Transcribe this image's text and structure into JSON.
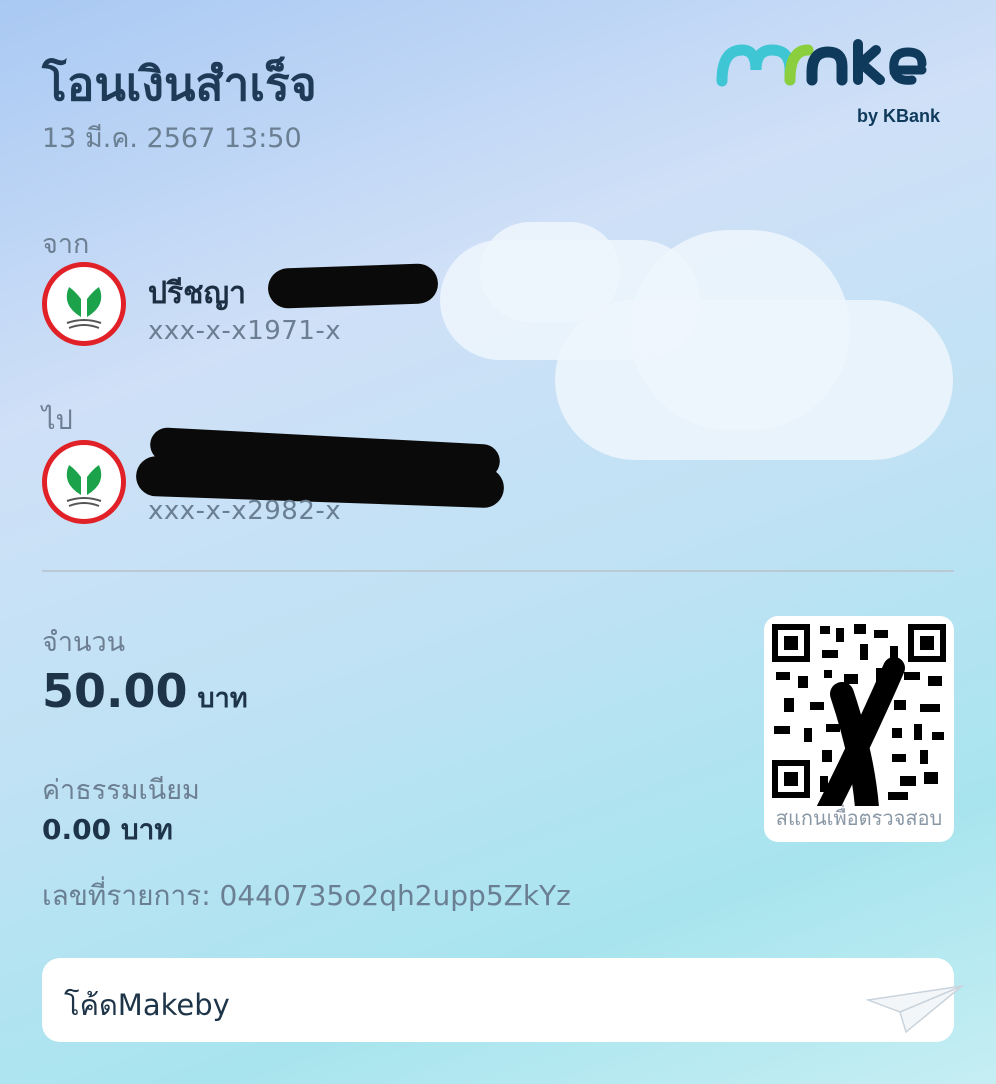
{
  "header": {
    "title": "โอนเงินสำเร็จ",
    "datetime": "13 มี.ค. 2567 13:50",
    "brand_logo_text": "make",
    "brand_sub": "by KBank"
  },
  "from": {
    "label": "จาก",
    "name": "ปรีชญา",
    "account": "xxx-x-x1971-x",
    "bank_icon": "kbank-leaf-icon"
  },
  "to": {
    "label": "ไป",
    "name": "",
    "account": "xxx-x-x2982-x",
    "bank_icon": "kbank-leaf-icon"
  },
  "amount": {
    "label": "จำนวน",
    "value": "50.00",
    "unit": "บาท"
  },
  "fee": {
    "label": "ค่าธรรมเนียม",
    "value": "0.00 บาท"
  },
  "reference": {
    "text": "เลขที่รายการ: 0440735o2qh2upp5ZkYz"
  },
  "qr": {
    "caption": "สแกนเพื่อตรวจสอบ"
  },
  "note": {
    "text": "โค้ดMakeby"
  },
  "colors": {
    "kbank_red": "#e02127",
    "kbank_green": "#1ba24b",
    "make_teal": "#3fc6d4",
    "make_green": "#8bcf3f",
    "make_navy": "#0f3a5c"
  }
}
